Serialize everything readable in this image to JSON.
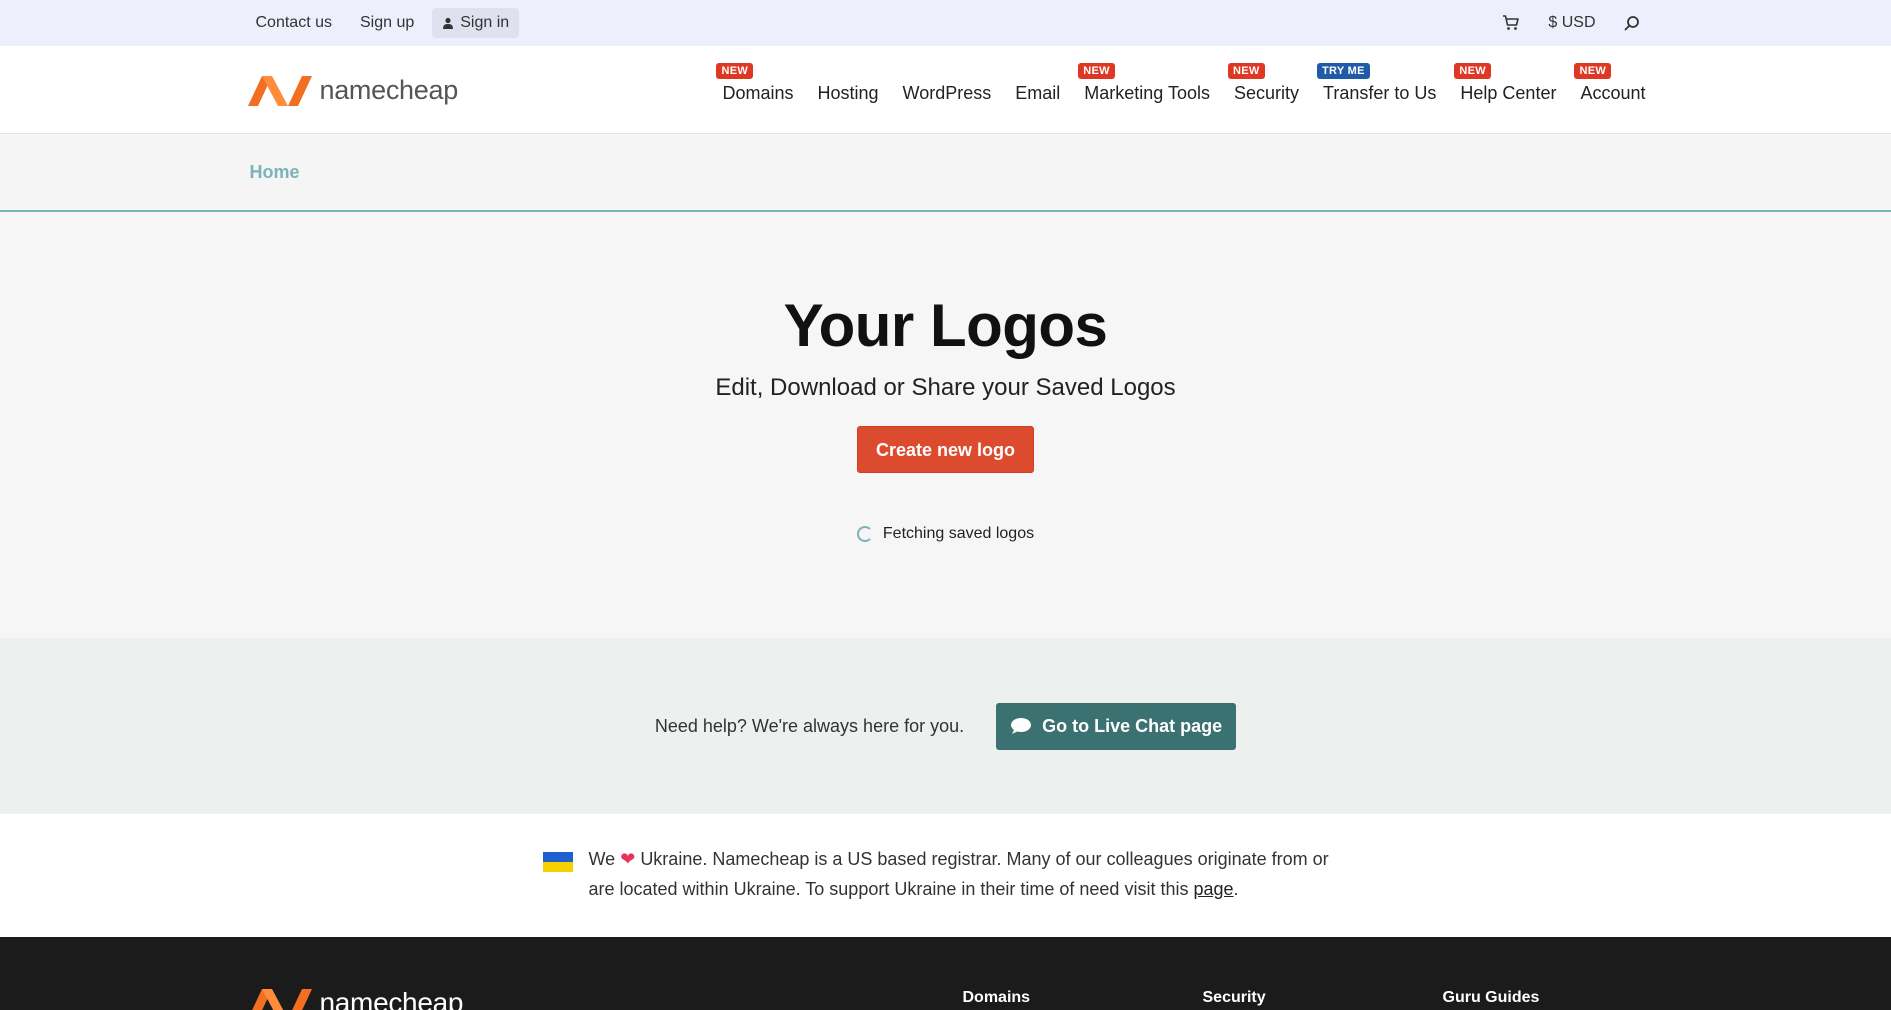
{
  "topbar": {
    "contact": "Contact us",
    "signup": "Sign up",
    "signin": "Sign in",
    "currency": "$ USD"
  },
  "header": {
    "logo_text": "namecheap",
    "nav": [
      {
        "label": "Domains",
        "badge": "NEW",
        "badge_color": "#de3723"
      },
      {
        "label": "Hosting",
        "badge": ""
      },
      {
        "label": "WordPress",
        "badge": ""
      },
      {
        "label": "Email",
        "badge": ""
      },
      {
        "label": "Marketing Tools",
        "badge": "NEW",
        "badge_color": "#de3723"
      },
      {
        "label": "Security",
        "badge": "NEW",
        "badge_color": "#de3723"
      },
      {
        "label": "Transfer to Us",
        "badge": "TRY ME",
        "badge_color": "#1f5ba6"
      },
      {
        "label": "Help Center",
        "badge": "NEW",
        "badge_color": "#de3723"
      },
      {
        "label": "Account",
        "badge": "NEW",
        "badge_color": "#de3723"
      }
    ]
  },
  "breadcrumb": {
    "home": "Home"
  },
  "hero": {
    "title": "Your Logos",
    "subtitle": "Edit, Download or Share your Saved Logos",
    "create_button": "Create new logo",
    "status": "Fetching saved logos"
  },
  "help": {
    "text": "Need help? We're always here for you.",
    "chat_button": "Go to Live Chat page"
  },
  "ukraine": {
    "pre": "We",
    "post": "Ukraine. Namecheap is a US based registrar. Many of our colleagues originate from or are located within Ukraine. To support Ukraine in their time of need visit this",
    "link": "page",
    "end": "."
  },
  "footer": {
    "logo_text": "namecheap",
    "columns": [
      "Domains",
      "Security",
      "Guru Guides"
    ]
  },
  "colors": {
    "accent": "#dd4b2f",
    "teal": "#3c7171",
    "breadcrumb": "#7bb3bb"
  }
}
